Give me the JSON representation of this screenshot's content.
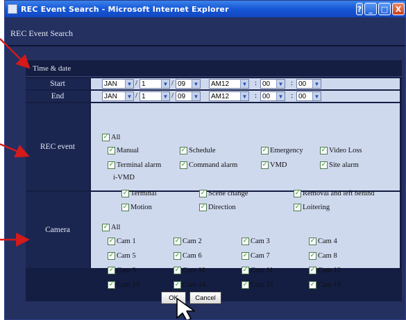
{
  "window": {
    "title": "REC Event Search - Microsoft Internet Explorer",
    "buttons": {
      "help": "?",
      "minimize": "_",
      "maximize": "□",
      "close": "X"
    }
  },
  "page": {
    "title": "REC Event Search"
  },
  "time_date": {
    "header": "Time & date",
    "start": {
      "label": "Start",
      "month": "JAN",
      "day": "1",
      "year": "09",
      "hour": "AM12",
      "minute": "00",
      "second": "00"
    },
    "end": {
      "label": "End",
      "month": "JAN",
      "day": "1",
      "year": "09",
      "hour": "AM12",
      "minute": "00",
      "second": "00"
    },
    "date_sep": "/",
    "time_sep": ":",
    "dropdown_icon": "chevron-down"
  },
  "rec_event": {
    "label": "REC event",
    "all": "All",
    "row1": [
      "Manual",
      "Schedule",
      "Emergency",
      "Video Loss"
    ],
    "row2": [
      "Terminal alarm",
      "Command alarm",
      "VMD",
      "Site alarm"
    ],
    "ivmd_label": "i-VMD",
    "ivmd_row1": [
      "Terminal",
      "Scene change",
      "Removal and left behind"
    ],
    "ivmd_row2": [
      "Motion",
      "Direction",
      "Loitering"
    ]
  },
  "camera": {
    "label": "Camera",
    "all": "All",
    "cams": [
      "Cam 1",
      "Cam 2",
      "Cam 3",
      "Cam 4",
      "Cam 5",
      "Cam 6",
      "Cam 7",
      "Cam 8",
      "Cam 9",
      "Cam 10",
      "Cam 11",
      "Cam 12",
      "Cam 13",
      "Cam 14",
      "Cam 15",
      "Cam 16"
    ]
  },
  "checkmark": "✓",
  "actions": {
    "ok": "OK",
    "cancel": "Cancel"
  },
  "colors": {
    "annotation_arrow": "#d41a1a",
    "cell_bg": "#cfd9ee",
    "window_bg": "#243060"
  }
}
